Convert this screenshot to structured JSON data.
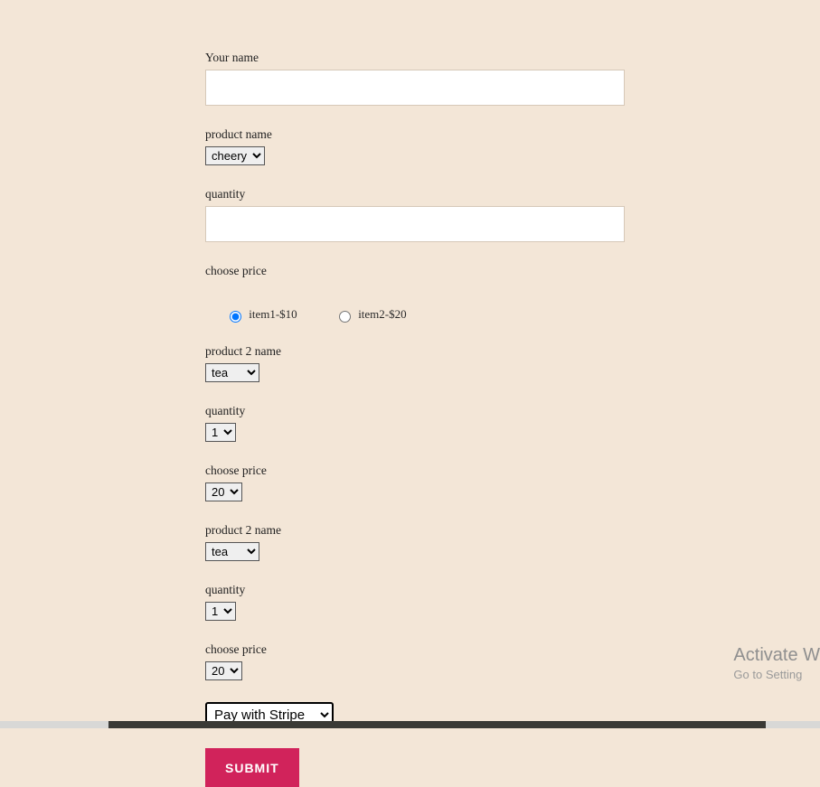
{
  "form": {
    "nameLabel": "Your name",
    "nameValue": "",
    "product1": {
      "label": "product name",
      "selected": "cheery"
    },
    "quantity1": {
      "label": "quantity",
      "value": ""
    },
    "price1": {
      "label": "choose price",
      "option1": "item1-$10",
      "option2": "item2-$20"
    },
    "product2a": {
      "label": "product 2 name",
      "selected": "tea"
    },
    "quantity2a": {
      "label": "quantity",
      "selected": "1"
    },
    "price2a": {
      "label": "choose price",
      "selected": "20"
    },
    "product2b": {
      "label": "product 2 name",
      "selected": "tea"
    },
    "quantity2b": {
      "label": "quantity",
      "selected": "1"
    },
    "price2b": {
      "label": "choose price",
      "selected": "20"
    },
    "payment": {
      "selected": "Pay with Stripe"
    },
    "submitLabel": "SUBMIT"
  },
  "watermark": {
    "title": "Activate W",
    "sub": "Go to Setting"
  }
}
